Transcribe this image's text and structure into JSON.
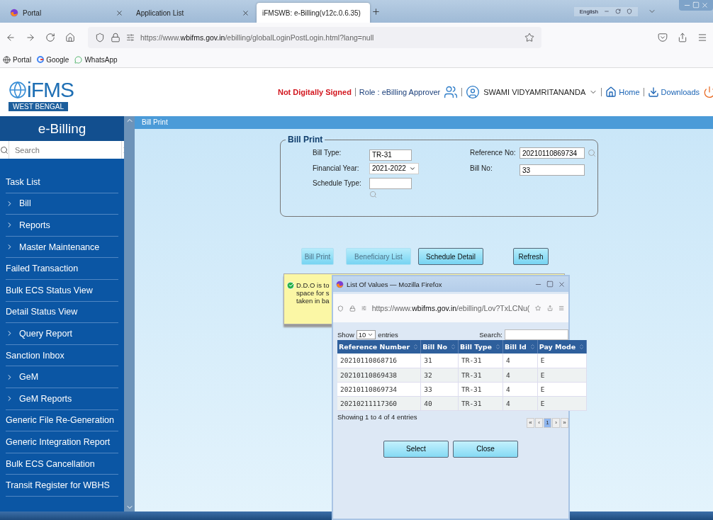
{
  "browser": {
    "tabs": [
      {
        "label": "Portal",
        "selected": false
      },
      {
        "label": "Application List",
        "selected": false
      },
      {
        "label": "iFMSWB: e-Billing(v12c.0.6.35)",
        "selected": true
      }
    ],
    "tray_label": "English",
    "url": "https://www.**wbifms.gov.in**/ebilling/globalLoginPostLogin.html?lang=null",
    "bookmarks": [
      "Portal",
      "Google",
      "WhatsApp"
    ]
  },
  "header": {
    "logo": "iFMS",
    "logo_sub": "WEST BENGAL",
    "signature_status": "Not Digitally Signed",
    "role": "Role : eBilling Approver",
    "user": "SWAMI VIDYAMRITANANDA",
    "links": [
      "Home",
      "Downloads"
    ]
  },
  "sidebar": {
    "title": "e-Billing",
    "search_placeholder": "Search",
    "items": [
      {
        "label": "Task List",
        "kind": "link"
      },
      {
        "label": "Bill",
        "kind": "group"
      },
      {
        "label": "Reports",
        "kind": "group"
      },
      {
        "label": "Master Maintenance",
        "kind": "group"
      },
      {
        "label": "Failed Transaction",
        "kind": "link"
      },
      {
        "label": "Bulk ECS Status View",
        "kind": "link"
      },
      {
        "label": "Detail Status View",
        "kind": "link"
      },
      {
        "label": "Query Report",
        "kind": "group"
      },
      {
        "label": "Sanction Inbox",
        "kind": "link"
      },
      {
        "label": "GeM",
        "kind": "group"
      },
      {
        "label": "GeM Reports",
        "kind": "group"
      },
      {
        "label": "Generic File Re-Generation",
        "kind": "link"
      },
      {
        "label": "Generic Integration Report",
        "kind": "link"
      },
      {
        "label": "Bulk ECS Cancellation",
        "kind": "link"
      },
      {
        "label": "Transit Register for WBHS",
        "kind": "link"
      }
    ]
  },
  "page": {
    "title": "Bill Print",
    "legend": "Bill Print",
    "fields": [
      {
        "label": "Bill Type:",
        "value": "TR-31",
        "kind": "text"
      },
      {
        "label": "Reference No:",
        "value": "20210110869734",
        "kind": "lookup"
      },
      {
        "label": "Financial Year:",
        "value": "2021-2022",
        "kind": "select"
      },
      {
        "label": "Bill No:",
        "value": "33",
        "kind": "text"
      },
      {
        "label": "Schedule Type:",
        "kind": "lookup"
      }
    ],
    "buttons": [
      {
        "label": "Bill Print",
        "disabled": true
      },
      {
        "label": "Beneficiary List",
        "disabled": true
      },
      {
        "label": "Schedule Detail",
        "disabled": false
      },
      {
        "label": "Refresh",
        "disabled": false
      }
    ],
    "notice": {
      "lines": [
        "D.D.O is to",
        "space for s",
        "taken in ba"
      ]
    }
  },
  "popup": {
    "title": "List Of Values — Mozilla Firefox",
    "url": "https://www.**wbifms.gov.in**/ebilling/Lov?TxLCNu(",
    "show_label": "Show",
    "page_size": "10",
    "entries_label": "entries",
    "search_label": "Search:",
    "columns": [
      "Reference Number",
      "Bill No",
      "Bill Type",
      "Bill Id",
      "Pay Mode"
    ],
    "rows": [
      [
        "20210110868716",
        "31",
        "TR-31",
        "4",
        "E"
      ],
      [
        "20210110869438",
        "32",
        "TR-31",
        "4",
        "E"
      ],
      [
        "20210110869734",
        "33",
        "TR-31",
        "4",
        "E"
      ],
      [
        "20210211117360",
        "40",
        "TR-31",
        "4",
        "E"
      ]
    ],
    "info": "Showing 1 to 4 of 4 entries",
    "pages": [
      {
        "label": "«",
        "selected": false
      },
      {
        "label": "‹",
        "selected": false
      },
      {
        "label": "1",
        "selected": true
      },
      {
        "label": "›",
        "selected": false
      },
      {
        "label": "»",
        "selected": false
      }
    ],
    "buttons": [
      "Select",
      "Close"
    ]
  }
}
